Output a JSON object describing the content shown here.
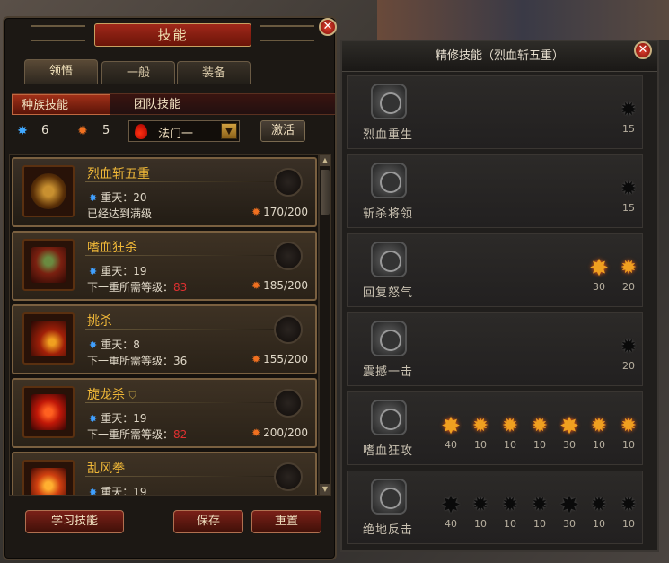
{
  "left_panel": {
    "title": "技能",
    "tabs": [
      "领悟",
      "一般",
      "装备"
    ],
    "subtabs": [
      "种族技能",
      "团队技能"
    ],
    "stats": {
      "star_points": "6",
      "flame_points": "5"
    },
    "class_select": "法门一",
    "activate_label": "激活",
    "skills": [
      {
        "name": "烈血斩五重",
        "level": "重天：20",
        "req_prefix": "已经达到满级",
        "req_val": "",
        "points": "170/200"
      },
      {
        "name": "嗜血狂杀",
        "level": "重天：19",
        "req_prefix": "下一重所需等级：",
        "req_val": "83",
        "points": "185/200"
      },
      {
        "name": "挑杀",
        "level": "重天：8",
        "req_prefix": "下一重所需等级：36",
        "req_val": "",
        "points": "155/200"
      },
      {
        "name": "旋龙杀",
        "level": "重天：19",
        "req_prefix": "下一重所需等级：",
        "req_val": "82",
        "points": "200/200"
      },
      {
        "name": "乱风拳",
        "level": "重天：19",
        "req_prefix": "",
        "req_val": "",
        "points": ""
      }
    ],
    "buttons": {
      "learn": "学习技能",
      "save": "保存",
      "reset": "重置"
    }
  },
  "right_panel": {
    "title": "精修技能（烈血斩五重）",
    "rows": [
      {
        "name": "烈血重生",
        "nodes": [
          {
            "value": "15",
            "active": false
          }
        ]
      },
      {
        "name": "斩杀将领",
        "nodes": [
          {
            "value": "15",
            "active": false
          }
        ]
      },
      {
        "name": "回复怒气",
        "nodes": [
          {
            "value": "30",
            "active": true
          },
          {
            "value": "20",
            "active": true
          }
        ]
      },
      {
        "name": "震撼一击",
        "nodes": [
          {
            "value": "20",
            "active": false
          }
        ]
      },
      {
        "name": "嗜血狂攻",
        "nodes": [
          {
            "value": "40",
            "active": true
          },
          {
            "value": "10",
            "active": true
          },
          {
            "value": "10",
            "active": true
          },
          {
            "value": "10",
            "active": true
          },
          {
            "value": "30",
            "active": true
          },
          {
            "value": "10",
            "active": true
          },
          {
            "value": "10",
            "active": true
          }
        ]
      },
      {
        "name": "绝地反击",
        "nodes": [
          {
            "value": "40",
            "active": false
          },
          {
            "value": "10",
            "active": false
          },
          {
            "value": "10",
            "active": false
          },
          {
            "value": "10",
            "active": false
          },
          {
            "value": "30",
            "active": false
          },
          {
            "value": "10",
            "active": false
          },
          {
            "value": "10",
            "active": false
          }
        ]
      }
    ]
  }
}
